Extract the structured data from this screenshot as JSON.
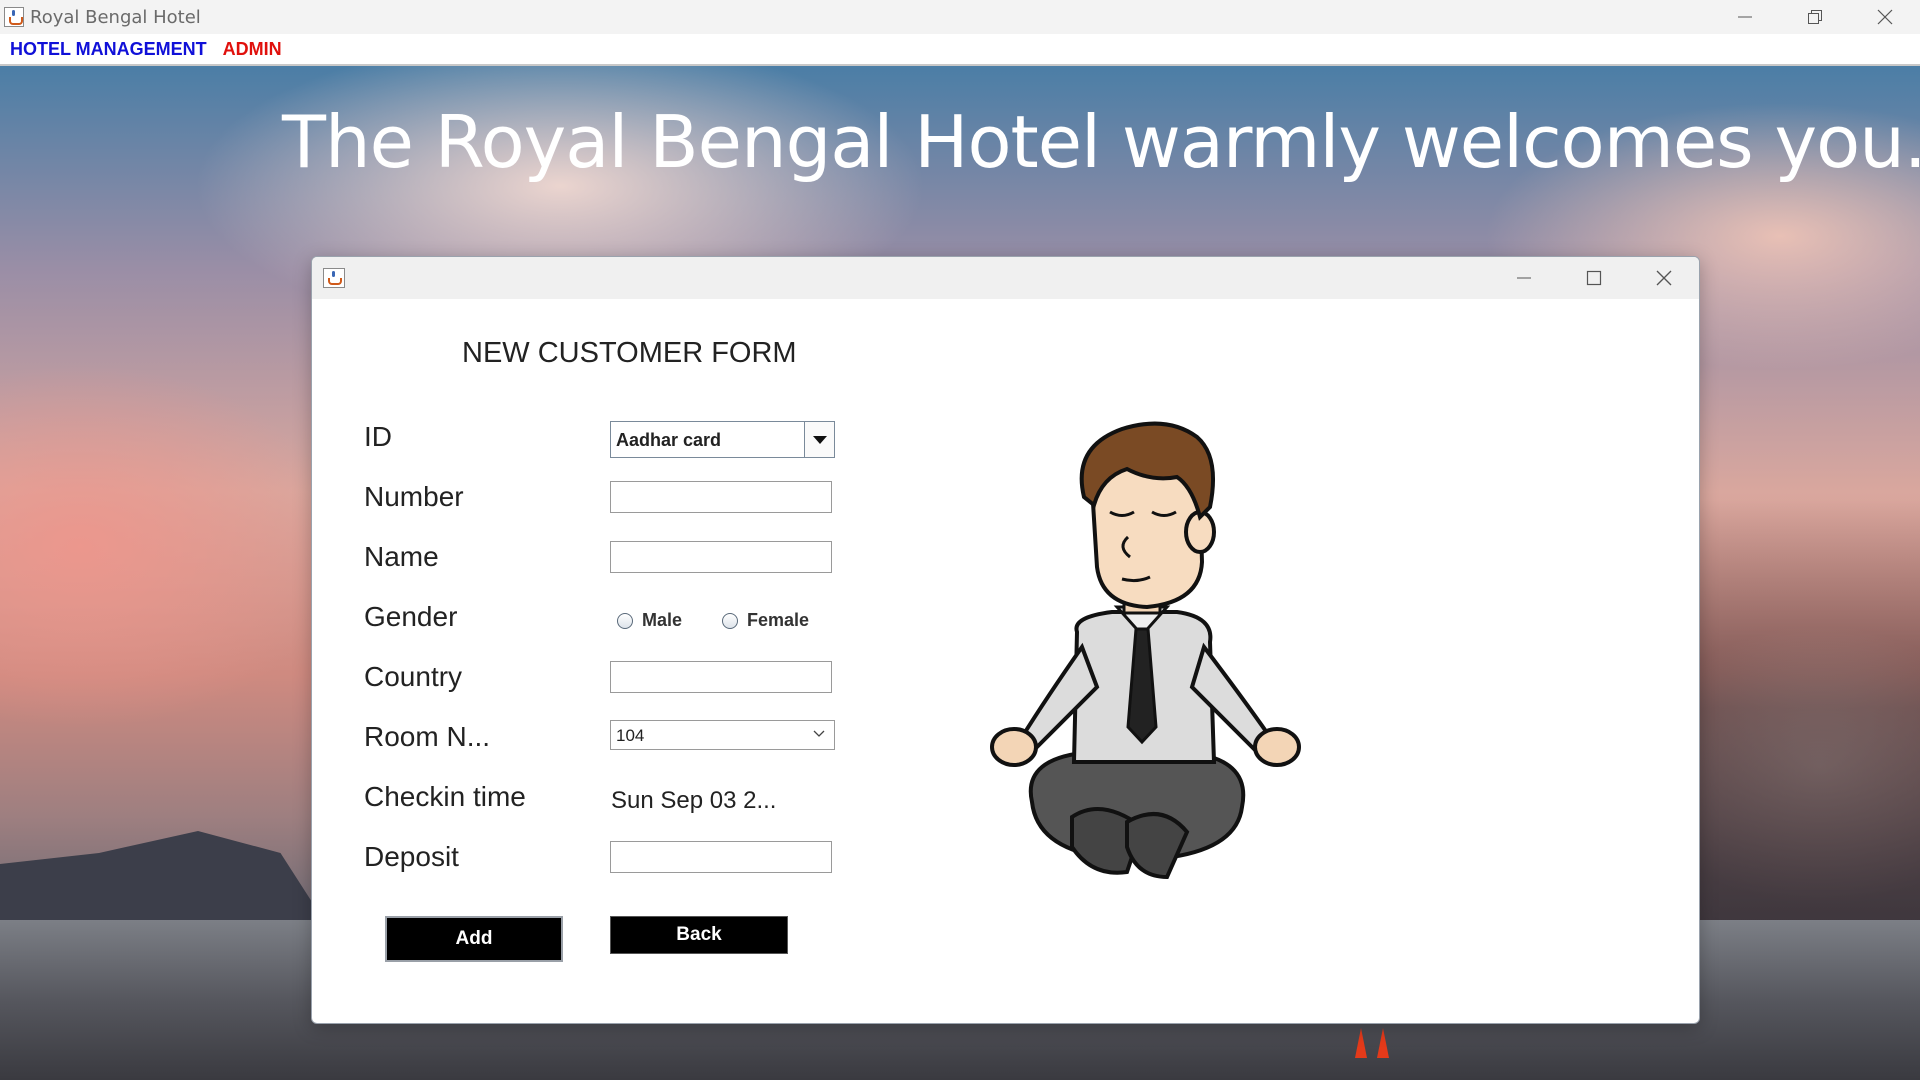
{
  "window": {
    "title": "Royal Bengal Hotel"
  },
  "menubar": {
    "items": [
      "HOTEL MANAGEMENT",
      "ADMIN"
    ]
  },
  "banner": {
    "welcome_text": "The Royal Bengal Hotel warmly welcomes you."
  },
  "dialog": {
    "form_title": "NEW CUSTOMER FORM",
    "labels": {
      "id": "ID",
      "number": "Number",
      "name": "Name",
      "gender": "Gender",
      "country": "Country",
      "room": "Room N...",
      "checkin": "Checkin time",
      "deposit": "Deposit"
    },
    "id_select": {
      "value": "Aadhar card"
    },
    "number_value": "",
    "name_value": "",
    "gender_options": [
      "Male",
      "Female"
    ],
    "country_value": "",
    "room_select": {
      "value": "104"
    },
    "checkin_value": "Sun Sep 03 2...",
    "deposit_value": "",
    "buttons": {
      "add": "Add",
      "back": "Back"
    }
  },
  "colors": {
    "menu_hotel": "#1010d8",
    "menu_admin": "#e0100c",
    "button_bg": "#000000",
    "button_text": "#ffffff"
  },
  "icons": [
    "java-app-icon",
    "minimize-icon",
    "restore-icon",
    "maximize-icon",
    "close-icon",
    "dropdown-arrow-icon",
    "chevron-down-icon",
    "meditating-man-illustration"
  ]
}
